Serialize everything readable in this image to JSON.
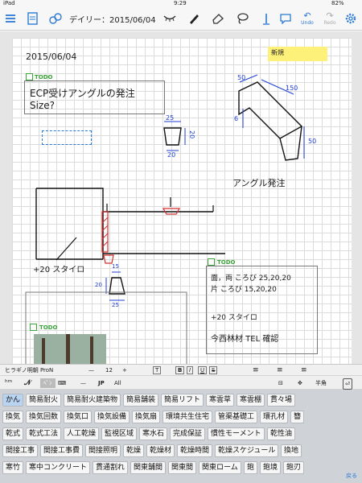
{
  "status_bar": {
    "device": "iPad",
    "time": "9:29",
    "battery": "82%"
  },
  "toolbar": {
    "title": "デイリー：2015/06/04",
    "undo_label": "Undo",
    "redo_label": "Redo"
  },
  "page": {
    "date": "2015/06/04",
    "sticky_note": "新規",
    "todo_label": "TODO",
    "note1": {
      "line1": "ECP受けアングルの発注",
      "line2": "Size?"
    },
    "dims_top": {
      "top": "25",
      "side": "20",
      "bottom": "20"
    },
    "dims_right": {
      "a": "50",
      "b": "150",
      "c": "6",
      "d": "50"
    },
    "angle_order": "アングル発注",
    "stairo_label": "+20 スタイロ",
    "dims_bottom": {
      "top": "15",
      "side": "20",
      "bottom": "25"
    },
    "note2": {
      "line1": "面，両 ころび 25,20,20",
      "line2": "片 ころび 15,20,20",
      "line3": "+20 スタイロ",
      "line4": "今西林材 TEL 確認"
    }
  },
  "format_bar": {
    "font_name": "ヒラギノ明朝 ProN",
    "font_size": "12",
    "minus": "—",
    "plus": "+",
    "bold": "B",
    "italic": "I",
    "underline": "U",
    "strike": "S"
  },
  "input_bar": {
    "jp": "JP",
    "all": "All",
    "width_label": "半角"
  },
  "ime": {
    "typed": "かん",
    "rows": [
      [
        "かん",
        "簡易耐火",
        "簡易耐火建築物",
        "簡易舗装",
        "簡易リフト",
        "寒雲草",
        "寒雲棚",
        "貫々場"
      ],
      [
        "換気",
        "換気回数",
        "換気口",
        "換気設備",
        "換気扇",
        "環境共生住宅",
        "管渠基礎工",
        "環孔材",
        "簪"
      ],
      [
        "乾式",
        "乾式工法",
        "人工乾燥",
        "監視区域",
        "寒水石",
        "完成保証",
        "慣性モーメント",
        "乾性油"
      ],
      [
        "間接工事",
        "間接工事費",
        "間接照明",
        "乾燥",
        "乾燥材",
        "乾燥時間",
        "乾燥スケジュール",
        "換地"
      ],
      [
        "寒竹",
        "寒中コンクリート",
        "貫通割れ",
        "関東舗間",
        "関東間",
        "関東ローム",
        "鉋",
        "鉋境",
        "鉋刃"
      ]
    ],
    "done": "戻る"
  },
  "colors": {
    "accent": "#2b7ad6",
    "todo_green": "#3aa33a",
    "sticky": "#fdf17a",
    "ink_blue": "#1f3fd6",
    "ink_red": "#d43030"
  }
}
